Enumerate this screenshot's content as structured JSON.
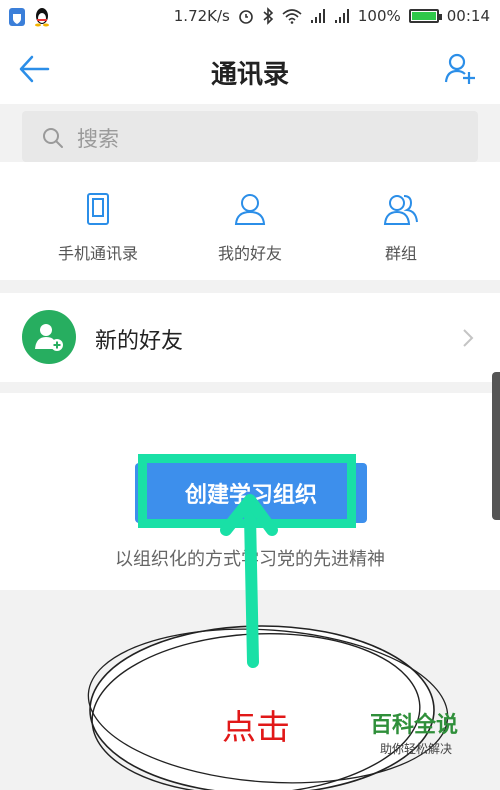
{
  "status_bar": {
    "network_speed": "1.72K/s",
    "battery_percent": "100%",
    "battery_level": 1.0,
    "time": "00:14",
    "icons": [
      "shield-icon",
      "qq-icon",
      "alarm-icon",
      "bluetooth-icon",
      "wifi-icon",
      "signal-icon",
      "signal-icon",
      "battery-icon"
    ]
  },
  "header": {
    "title": "通讯录",
    "back_icon": "back-arrow-icon",
    "add_icon": "add-contact-icon"
  },
  "search": {
    "placeholder": "搜索",
    "icon": "search-icon"
  },
  "quick_menu": [
    {
      "label": "手机通讯录",
      "icon": "phone-icon"
    },
    {
      "label": "我的好友",
      "icon": "person-icon"
    },
    {
      "label": "群组",
      "icon": "group-icon"
    }
  ],
  "new_friends": {
    "label": "新的好友",
    "icon": "add-friend-avatar-icon",
    "chevron": "chevron-right-icon"
  },
  "group": {
    "button_label": "创建学习组织",
    "description": "以组织化的方式学习党的先进精神"
  },
  "annotation": {
    "text": "点击"
  },
  "watermark": {
    "title": "百科全说",
    "subtitle": "助你轻松解决"
  },
  "colors": {
    "accent": "#3d8fec",
    "icon_blue": "#2b8ee8",
    "highlight": "#19e0a6",
    "avatar_green": "#27ae60",
    "annotation_red": "#e11818",
    "watermark_green": "#2f8f3a"
  }
}
